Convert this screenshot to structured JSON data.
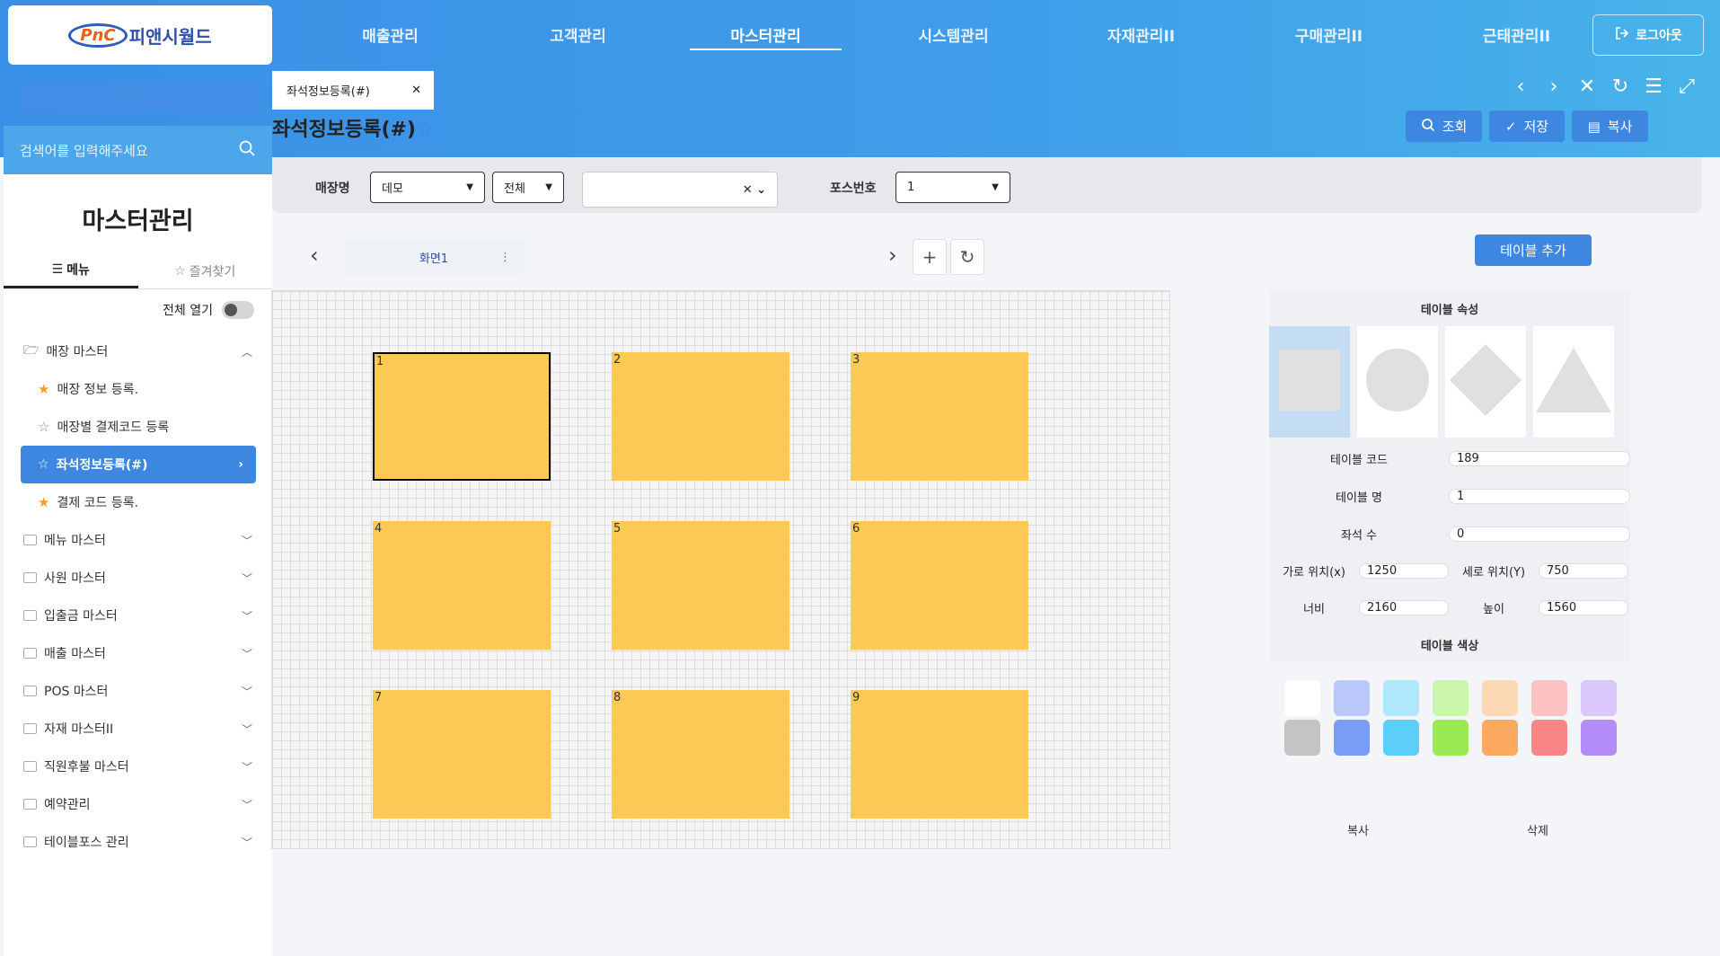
{
  "header": {
    "logo_mark": "PnC",
    "logo_text": "피앤시월드",
    "nav": [
      "매출관리",
      "고객관리",
      "마스터관리",
      "시스템관리",
      "자재관리II",
      "구매관리II",
      "근태관리II"
    ],
    "active_nav": "마스터관리",
    "logout_label": "로그아웃"
  },
  "search": {
    "placeholder": "검색어를 입력해주세요"
  },
  "sidebar": {
    "title": "마스터관리",
    "tab_menu": "메뉴",
    "tab_favorites": "즐겨찾기",
    "expand_all_label": "전체 열기",
    "items": [
      {
        "label": "매장 마스터",
        "type": "group-open"
      },
      {
        "label": "매장 정보 등록.",
        "type": "sub",
        "star": "filled"
      },
      {
        "label": "매장별 결제코드 등록",
        "type": "sub",
        "star": "outline"
      },
      {
        "label": "좌석정보등록(#)",
        "type": "sub-selected",
        "star": "outline"
      },
      {
        "label": "결제 코드 등록.",
        "type": "sub",
        "star": "filled"
      },
      {
        "label": "메뉴 마스터",
        "type": "group"
      },
      {
        "label": "사원 마스터",
        "type": "group"
      },
      {
        "label": "입출금 마스터",
        "type": "group"
      },
      {
        "label": "매출 마스터",
        "type": "group"
      },
      {
        "label": "POS 마스터",
        "type": "group"
      },
      {
        "label": "자재 마스터II",
        "type": "group"
      },
      {
        "label": "직원후불 마스터",
        "type": "group"
      },
      {
        "label": "예약관리",
        "type": "group"
      },
      {
        "label": "테이블포스 관리",
        "type": "group"
      }
    ]
  },
  "doc_tab": {
    "label": "좌석정보등록(#)"
  },
  "page": {
    "title": "좌석정보등록(#)"
  },
  "actions": {
    "query": "조회",
    "save": "저장",
    "copy": "복사"
  },
  "filters": {
    "store_label": "매장명",
    "store_value": "데모",
    "scope_value": "전체",
    "combo_value": "",
    "pos_label": "포스번호",
    "pos_value": "1"
  },
  "screen": {
    "name": "화면1"
  },
  "add_table_label": "테이블 추가",
  "seats": [
    "1",
    "2",
    "3",
    "4",
    "5",
    "6",
    "7",
    "8",
    "9"
  ],
  "selected_seat": "1",
  "properties": {
    "header": "테이블 속성",
    "shapes": [
      "square",
      "circle",
      "diamond",
      "triangle"
    ],
    "selected_shape": "square",
    "table_code_label": "테이블 코드",
    "table_code": "189",
    "table_name_label": "테이블 명",
    "table_name": "1",
    "seat_count_label": "좌석 수",
    "seat_count": "0",
    "pos_x_label": "가로 위치(x)",
    "pos_x": "1250",
    "pos_y_label": "세로 위치(Y)",
    "pos_y": "750",
    "width_label": "너비",
    "width": "2160",
    "height_label": "높이",
    "height": "1560",
    "color_header": "테이블 색상",
    "colors": [
      "#ffffff",
      "#b9c7fb",
      "#b0e8fb",
      "#c9f6a8",
      "#fdd8b4",
      "#fdc2c2",
      "#dac7fb",
      "#c4c4c4",
      "#7b9cf7",
      "#5ccefa",
      "#9aeb53",
      "#fbaa5f",
      "#f98686",
      "#b38cf7"
    ],
    "copy_label": "복사",
    "delete_label": "삭제"
  }
}
